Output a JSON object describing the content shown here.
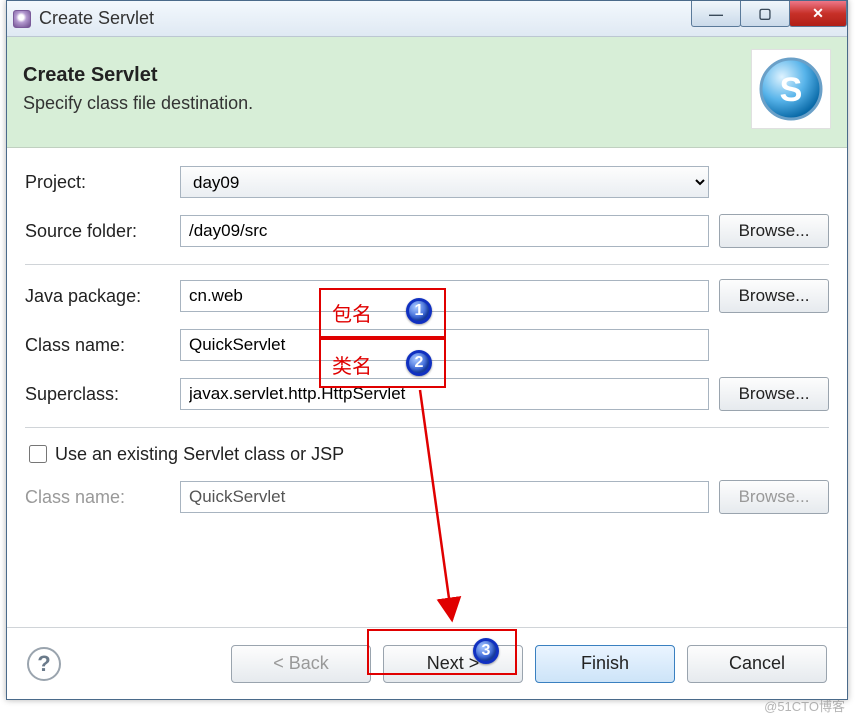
{
  "window": {
    "title": "Create Servlet"
  },
  "titlebar_controls": {
    "minimize": "—",
    "maximize": "▢",
    "close": "✕"
  },
  "header": {
    "title": "Create Servlet",
    "subtitle": "Specify class file destination.",
    "icon_letter": "S"
  },
  "fields": {
    "project_label": "Project:",
    "project_value": "day09",
    "source_folder_label": "Source folder:",
    "source_folder_value": "/day09/src",
    "java_package_label": "Java package:",
    "java_package_value": "cn.web",
    "class_name_label": "Class name:",
    "class_name_value": "QuickServlet",
    "superclass_label": "Superclass:",
    "superclass_value": "javax.servlet.http.HttpServlet",
    "use_existing_label": "Use an existing Servlet class or JSP",
    "existing_class_label": "Class name:",
    "existing_class_value": "QuickServlet"
  },
  "buttons": {
    "browse": "Browse...",
    "help": "?",
    "back": "< Back",
    "next": "Next >",
    "finish": "Finish",
    "cancel": "Cancel"
  },
  "annotations": {
    "label1": "包名",
    "label2": "类名",
    "num1": "1",
    "num2": "2",
    "num3": "3"
  },
  "watermark": "@51CTO博客"
}
